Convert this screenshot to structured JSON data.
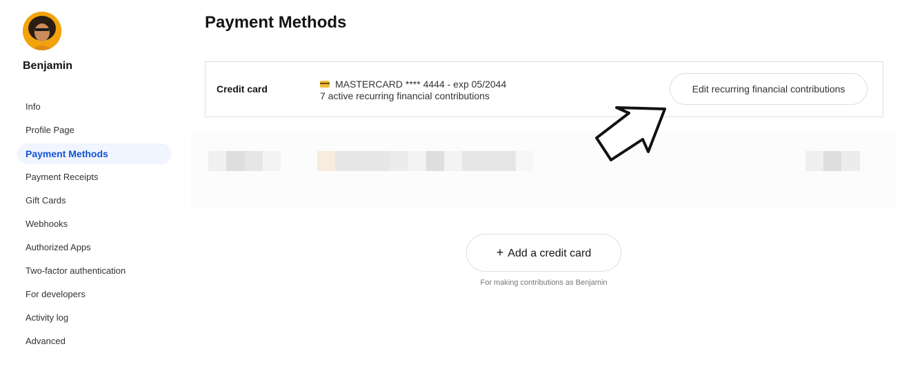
{
  "user": {
    "name": "Benjamin"
  },
  "sidebar": {
    "items": [
      {
        "label": "Info",
        "active": false
      },
      {
        "label": "Profile Page",
        "active": false
      },
      {
        "label": "Payment Methods",
        "active": true
      },
      {
        "label": "Payment Receipts",
        "active": false
      },
      {
        "label": "Gift Cards",
        "active": false
      },
      {
        "label": "Webhooks",
        "active": false
      },
      {
        "label": "Authorized Apps",
        "active": false
      },
      {
        "label": "Two-factor authentication",
        "active": false
      },
      {
        "label": "For developers",
        "active": false
      },
      {
        "label": "Activity log",
        "active": false
      },
      {
        "label": "Advanced",
        "active": false
      }
    ]
  },
  "main": {
    "title": "Payment Methods",
    "card": {
      "type_label": "Credit card",
      "icon": "credit-card-icon",
      "number_line": "MASTERCARD **** 4444 - exp 05/2044",
      "contributions_line": "7 active recurring financial contributions",
      "edit_button": "Edit recurring financial contributions"
    },
    "add_card": {
      "plus": "+",
      "label": "Add a credit card",
      "hint": "For making contributions as Benjamin"
    }
  },
  "colors": {
    "accent": "#1153d6",
    "active_bg": "#f0f5ff",
    "border": "#dcdee0",
    "text": "#313233"
  }
}
